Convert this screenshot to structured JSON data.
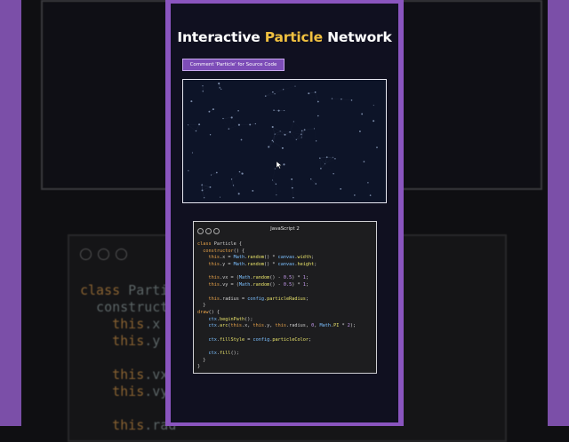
{
  "header": {
    "title_part1": "Interactive ",
    "title_highlight": "Particle",
    "title_part2": " Network",
    "highlight_color": "#f0c040"
  },
  "cta": {
    "label": "Comment 'Particle' for Source Code"
  },
  "canvas": {
    "background": "#0d1428",
    "particle_color": "#7a8aa8",
    "cursor_icon": "mouse-pointer-icon"
  },
  "code_window": {
    "title": "JavaScript 2",
    "lines": [
      "class Particle {",
      "  constructor() {",
      "    this.x = Math.random() * canvas.width;",
      "    this.y = Math.random() * canvas.height;",
      "",
      "    this.vx = (Math.random() - 0.5) * 1;",
      "    this.vy = (Math.random() - 0.5) * 1;",
      "",
      "    this.radius = config.particleRadius;",
      "  }",
      "draw() {",
      "    ctx.beginPath();",
      "    ctx.arc(this.x, this.y, this.radius, 0, Math.PI * 2);",
      "",
      "    ctx.fillStyle = config.particleColor;",
      "",
      "    ctx.fill();",
      "  }",
      "}"
    ]
  },
  "background": {
    "code_lines": [
      "class Parti",
      "  construct",
      "    this.x =",
      "    this.y =",
      "",
      "    this.vx",
      "    this.vy",
      "",
      "    this.rad"
    ]
  },
  "colors": {
    "frame_purple": "#8a55bf",
    "side_purple": "#7b4fa8",
    "content_bg": "#101020",
    "button_bg": "#7d4db8"
  }
}
